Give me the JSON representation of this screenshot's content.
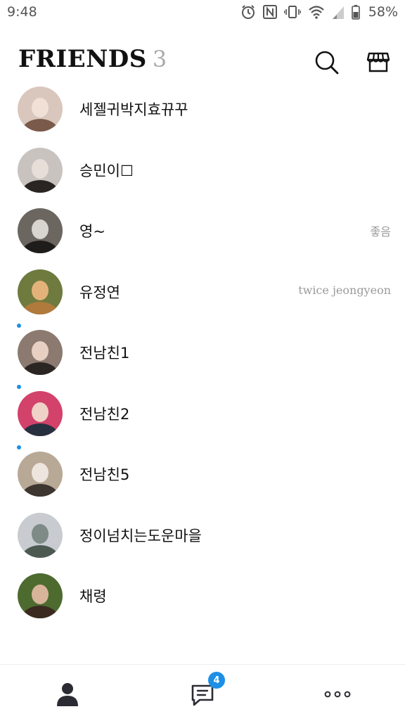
{
  "status_bar": {
    "time": "9:48",
    "battery": "58%"
  },
  "header": {
    "title": "FRIENDS",
    "count": "3"
  },
  "friends": [
    {
      "name": "세젤귀박지효뀨꾸",
      "status_message": "",
      "new": false,
      "avatar_colors": [
        "#d9c7bd",
        "#7a5a4a",
        "#f1e0d6"
      ]
    },
    {
      "name": "승민이☐",
      "status_message": "",
      "new": false,
      "avatar_colors": [
        "#c9c3c0",
        "#2a2522",
        "#e8ded8"
      ]
    },
    {
      "name": "영~",
      "status_message": "좋음",
      "new": false,
      "avatar_colors": [
        "#6b6660",
        "#1f1d1b",
        "#d8d4d0"
      ]
    },
    {
      "name": "유정연",
      "status_message": "twice jeongyeon",
      "new": false,
      "avatar_colors": [
        "#6e7a3e",
        "#b07a3c",
        "#e3b27a"
      ]
    },
    {
      "name": "전남친1",
      "status_message": "",
      "new": true,
      "avatar_colors": [
        "#8c7a70",
        "#2b2624",
        "#e7cfc2"
      ]
    },
    {
      "name": "전남친2",
      "status_message": "",
      "new": true,
      "avatar_colors": [
        "#d2426a",
        "#27303f",
        "#f0d1c8"
      ]
    },
    {
      "name": "전남친5",
      "status_message": "",
      "new": true,
      "avatar_colors": [
        "#b8a896",
        "#3c3530",
        "#eee6de"
      ]
    },
    {
      "name": "정이넘치는도운마을",
      "status_message": "",
      "new": false,
      "avatar_colors": [
        "#c8ccd0",
        "#4d5a52",
        "#7e8b86"
      ]
    },
    {
      "name": "채령",
      "status_message": "",
      "new": false,
      "avatar_colors": [
        "#4d6b2f",
        "#3a2a20",
        "#d8b49a"
      ]
    }
  ],
  "bottom_nav": {
    "items": [
      {
        "id": "friends",
        "icon": "person-icon",
        "active": true
      },
      {
        "id": "chats",
        "icon": "chat-bubble-icon",
        "badge": "4"
      },
      {
        "id": "more",
        "icon": "more-dots-icon"
      }
    ]
  },
  "colors": {
    "accent": "#1e8fe6",
    "text": "#111111",
    "muted": "#9a9a9a"
  }
}
